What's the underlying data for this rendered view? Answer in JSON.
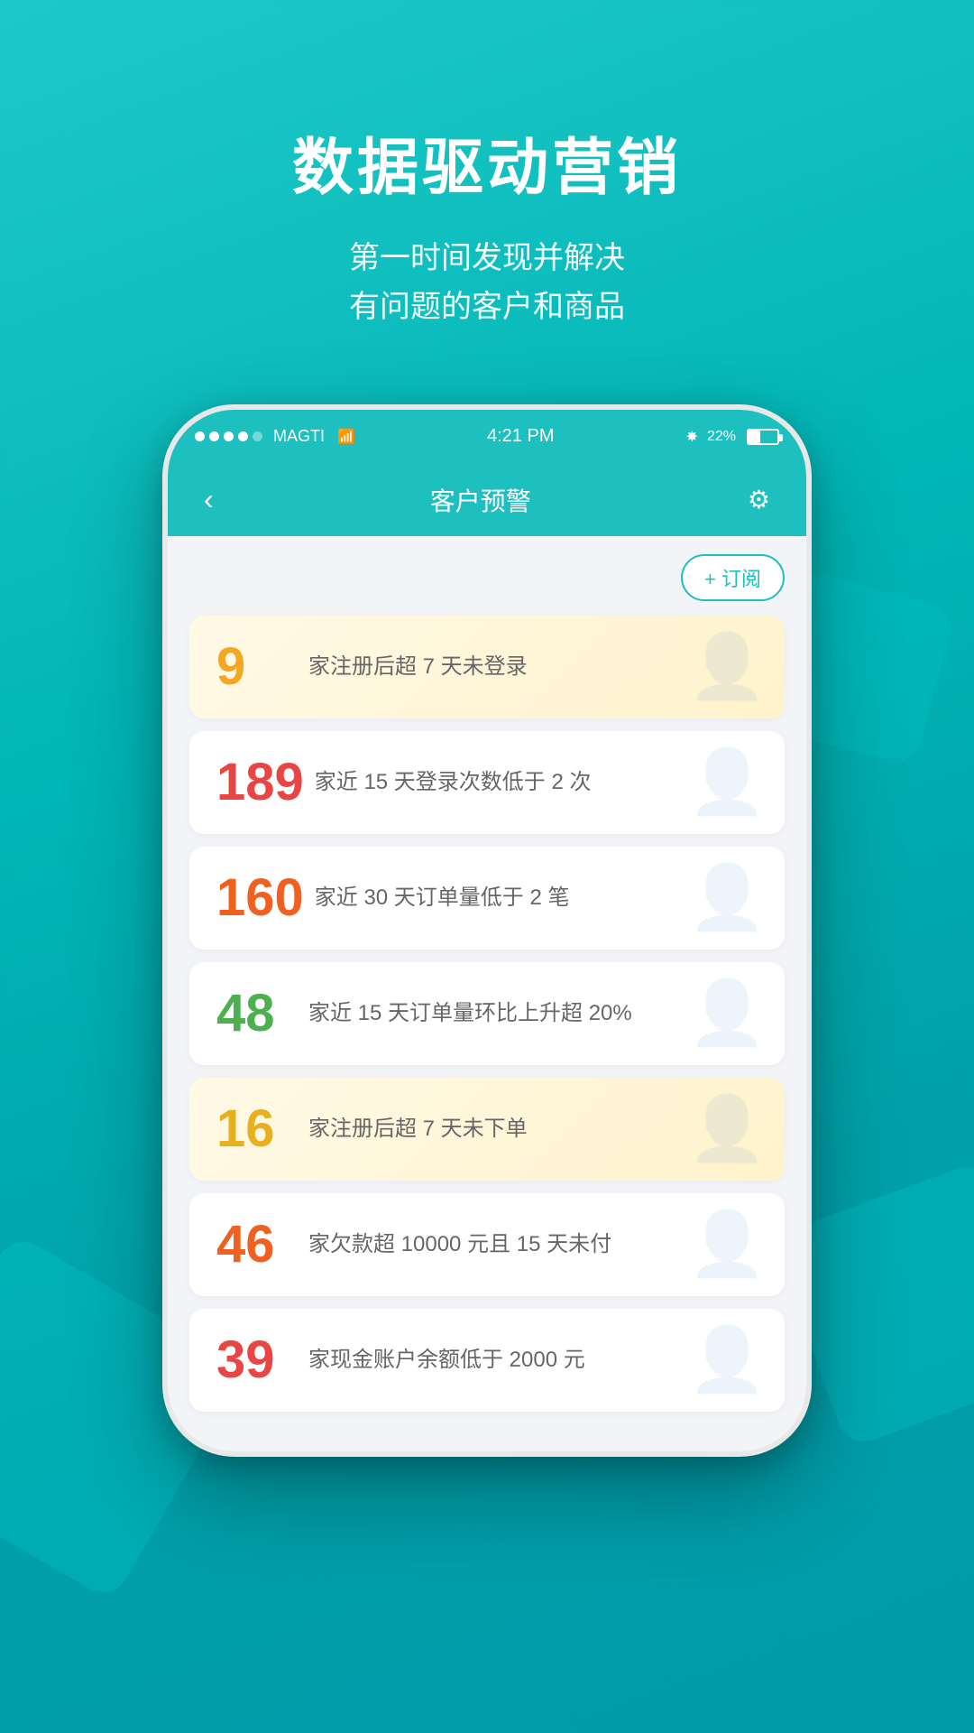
{
  "background": {
    "color1": "#1fc8c8",
    "color2": "#009aaa"
  },
  "header": {
    "title": "数据驱动营销",
    "subtitle_line1": "第一时间发现并解决",
    "subtitle_line2": "有问题的客户和商品"
  },
  "status_bar": {
    "carrier": "MAGTI",
    "wifi_icon": "wifi",
    "time": "4:21 PM",
    "bluetooth_icon": "bluetooth",
    "battery_percent": "22%"
  },
  "nav": {
    "back_icon": "‹",
    "title": "客户预警",
    "gear_icon": "⚙"
  },
  "subscribe_button": "+ 订阅",
  "alerts": [
    {
      "number": "9",
      "number_class": "num-orange",
      "text": "家注册后超 7 天未登录",
      "bg": "yellow-bg"
    },
    {
      "number": "189",
      "number_class": "num-red",
      "text": "家近 15 天登录次数低于 2 次",
      "bg": "light-bg"
    },
    {
      "number": "160",
      "number_class": "num-orange-red",
      "text": "家近 30 天订单量低于 2 笔",
      "bg": "light-bg"
    },
    {
      "number": "48",
      "number_class": "num-green",
      "text": "家近 15 天订单量环比上升超 20%",
      "bg": "light-bg"
    },
    {
      "number": "16",
      "number_class": "num-yellow",
      "text": "家注册后超 7 天未下单",
      "bg": "yellow-bg"
    },
    {
      "number": "46",
      "number_class": "num-orange-red",
      "text": "家欠款超 10000 元且 15 天未付",
      "bg": "light-bg"
    },
    {
      "number": "39",
      "number_class": "num-red",
      "text": "家现金账户余额低于 2000 元",
      "bg": "light-bg"
    }
  ]
}
